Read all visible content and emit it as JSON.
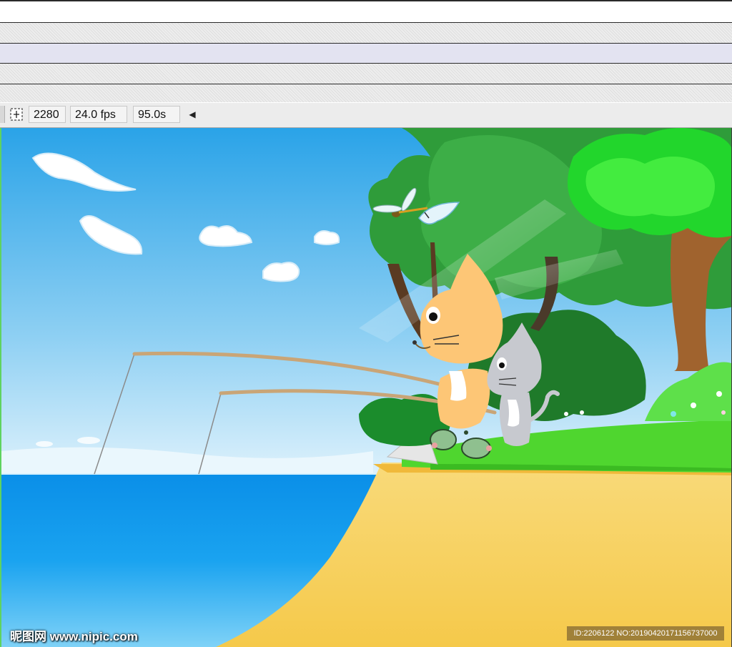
{
  "timeline": {
    "frame_number": "2280",
    "frame_rate": "24.0 fps",
    "elapsed_time": "95.0s"
  },
  "watermark": {
    "site": "昵图网 www.nipic.com",
    "id_text": "ID:2206122 NO:20190420171156737000"
  },
  "icons": {
    "center_frame": "center-frame-icon",
    "scroll_left": "scroll-left-arrow-icon"
  },
  "colors": {
    "sky_top": "#2aa3e8",
    "sea": "#0a8fe8",
    "sand": "#f7d46c",
    "grass": "#4fd62f",
    "stage_border": "#5fd35f"
  }
}
